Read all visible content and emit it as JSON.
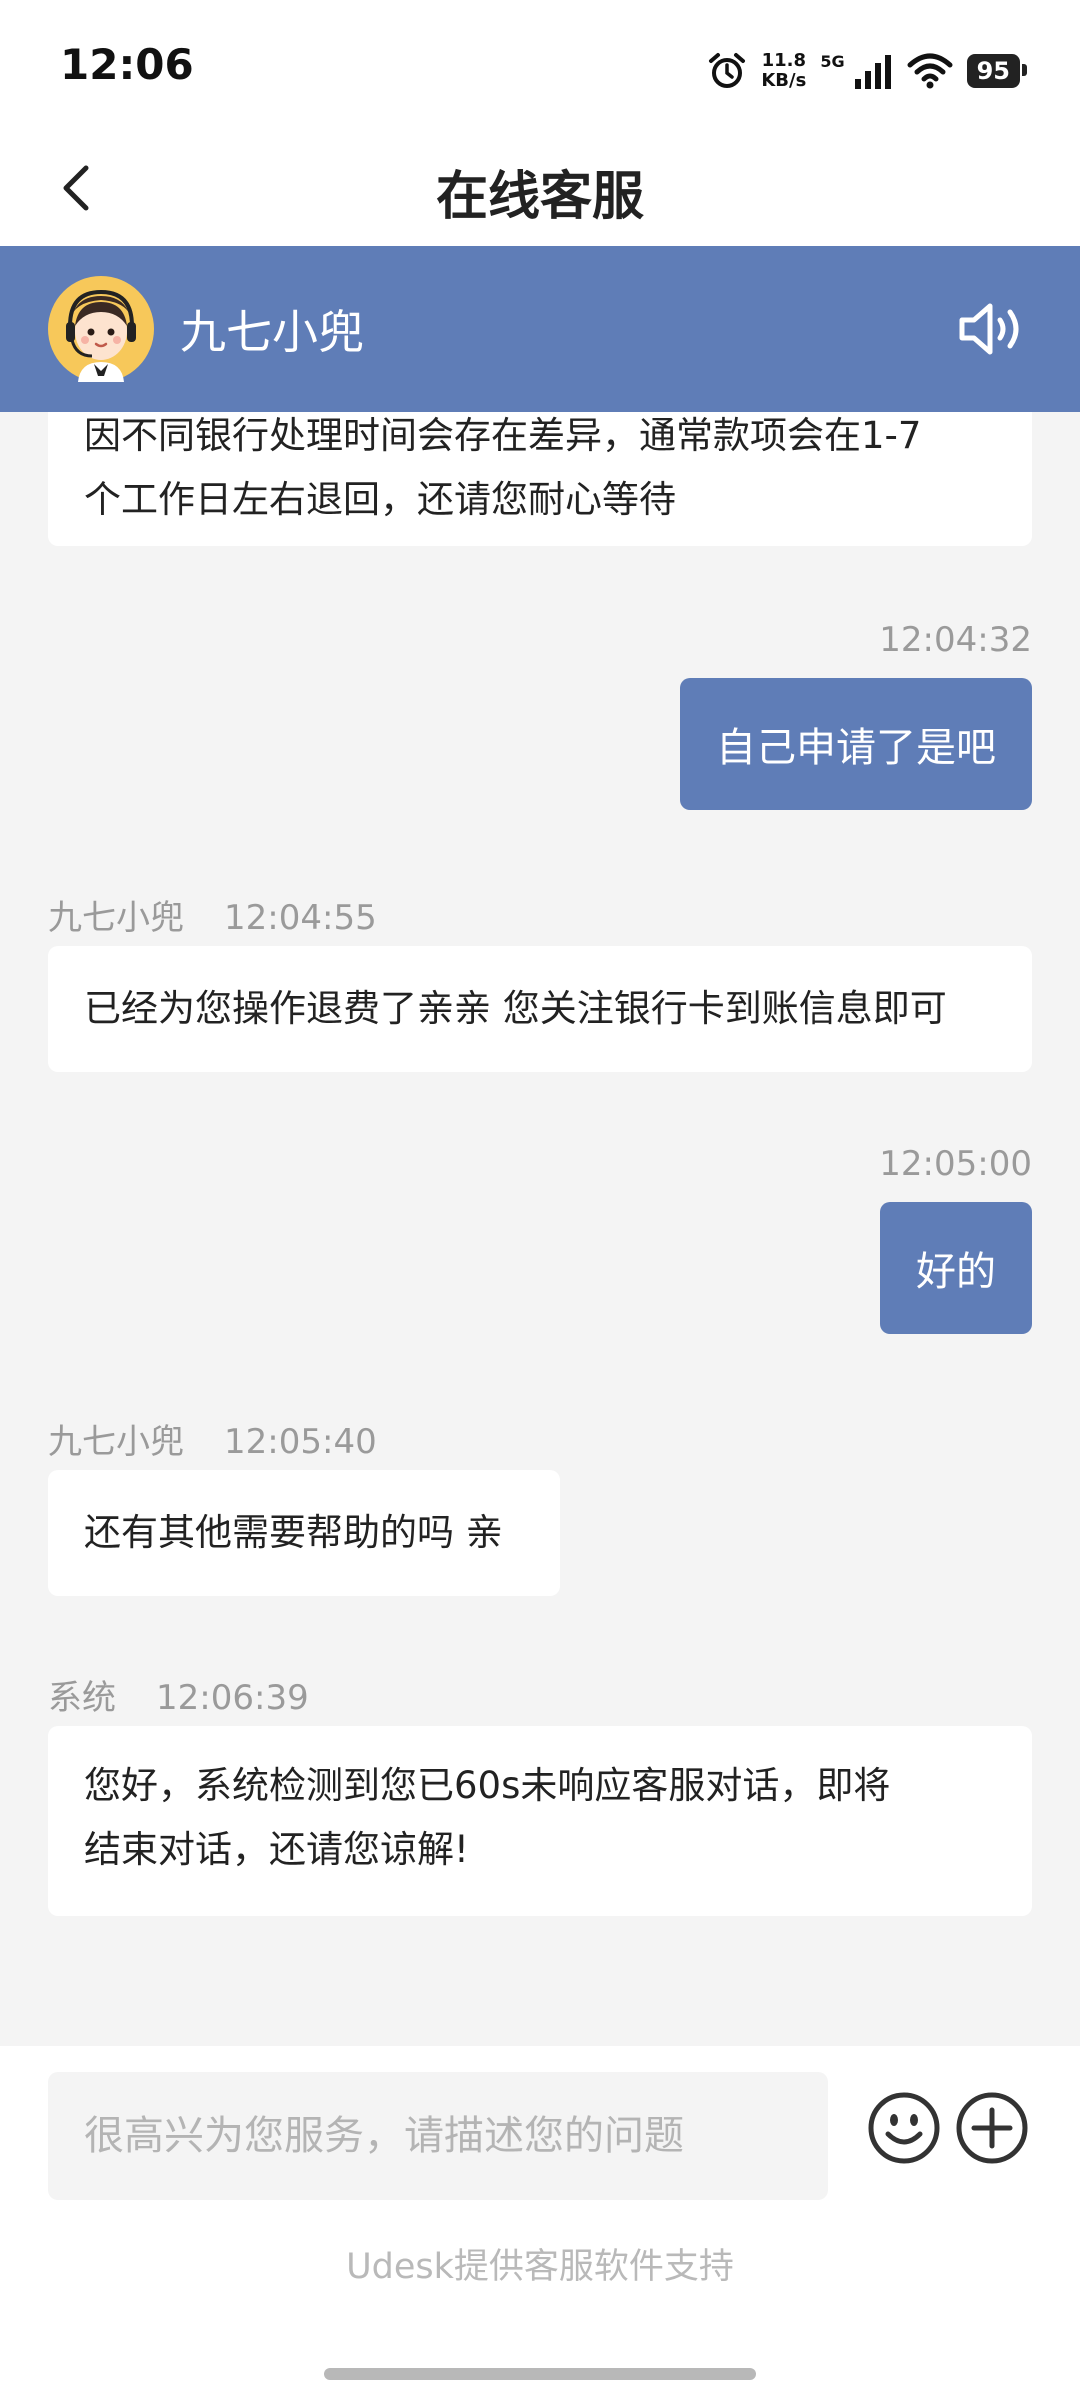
{
  "status_bar": {
    "time": "12:06",
    "net_speed_value": "11.8",
    "net_speed_unit": "KB/s",
    "network": "5G",
    "battery": "95"
  },
  "nav": {
    "title": "在线客服"
  },
  "agent": {
    "name": "九七小兜"
  },
  "messages": {
    "m1": {
      "line1": "因不同银行处理时间会存在差异，通常款项会在1-7",
      "line2": "个工作日左右退回，还请您耐心等待"
    },
    "m2": {
      "time": "12:04:32",
      "text": "自己申请了是吧"
    },
    "m3": {
      "sender": "九七小兜",
      "time": "12:04:55",
      "text": "已经为您操作退费了亲亲 您关注银行卡到账信息即可"
    },
    "m4": {
      "time": "12:05:00",
      "text": "好的"
    },
    "m5": {
      "sender": "九七小兜",
      "time": "12:05:40",
      "text": "还有其他需要帮助的吗 亲"
    },
    "m6": {
      "sender": "系统",
      "time": "12:06:39",
      "line1": "您好，系统检测到您已60s未响应客服对话，即将",
      "line2": "结束对话，还请您谅解!"
    }
  },
  "footer": {
    "input_placeholder": "很高兴为您服务，请描述您的问题",
    "powered_by": "Udesk提供客服软件支持"
  },
  "colors": {
    "brand": "#5f7db7",
    "background": "#f4f4f4",
    "bubble_left": "#ffffff",
    "meta_text": "#9a9a9a"
  },
  "icons": {
    "back": "chevron-left-icon",
    "speaker": "speaker-icon",
    "emoji": "smiley-icon",
    "plus": "plus-circle-icon",
    "alarm": "alarm-icon",
    "signal": "signal-icon",
    "wifi": "wifi-icon"
  }
}
